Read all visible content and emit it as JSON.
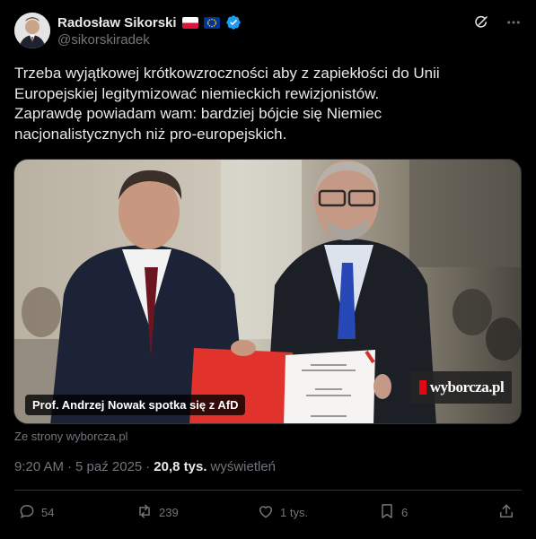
{
  "author": {
    "display_name": "Radosław Sikorski",
    "handle": "@sikorskiradek"
  },
  "tweet": {
    "text": "Trzeba wyjątkowej krótkowzroczności aby z zapiekłości do Unii\nEuropejskiej legitymizować niemieckich rewizjonistów.\nZaprawdę powiadam wam: bardziej bójcie się Niemiec\nnacjonalistycznych niż pro-europejskich."
  },
  "media": {
    "caption": "Prof. Andrzej Nowak spotka się z AfD",
    "logo": "wyborcza.pl"
  },
  "link_source": "Ze strony wyborcza.pl",
  "meta": {
    "time": "9:20 AM",
    "separator": "·",
    "date": "5 paź 2025",
    "dot": "·",
    "views_count": "20,8 tys.",
    "views_label": "wyświetleń"
  },
  "actions": {
    "replies": "54",
    "reposts": "239",
    "likes": "1 tys.",
    "bookmarks": "6"
  },
  "colors": {
    "background": "#000000",
    "text": "#e7e9ea",
    "muted": "#71767b",
    "border": "#2f3336",
    "verified": "#1d9bf0"
  }
}
